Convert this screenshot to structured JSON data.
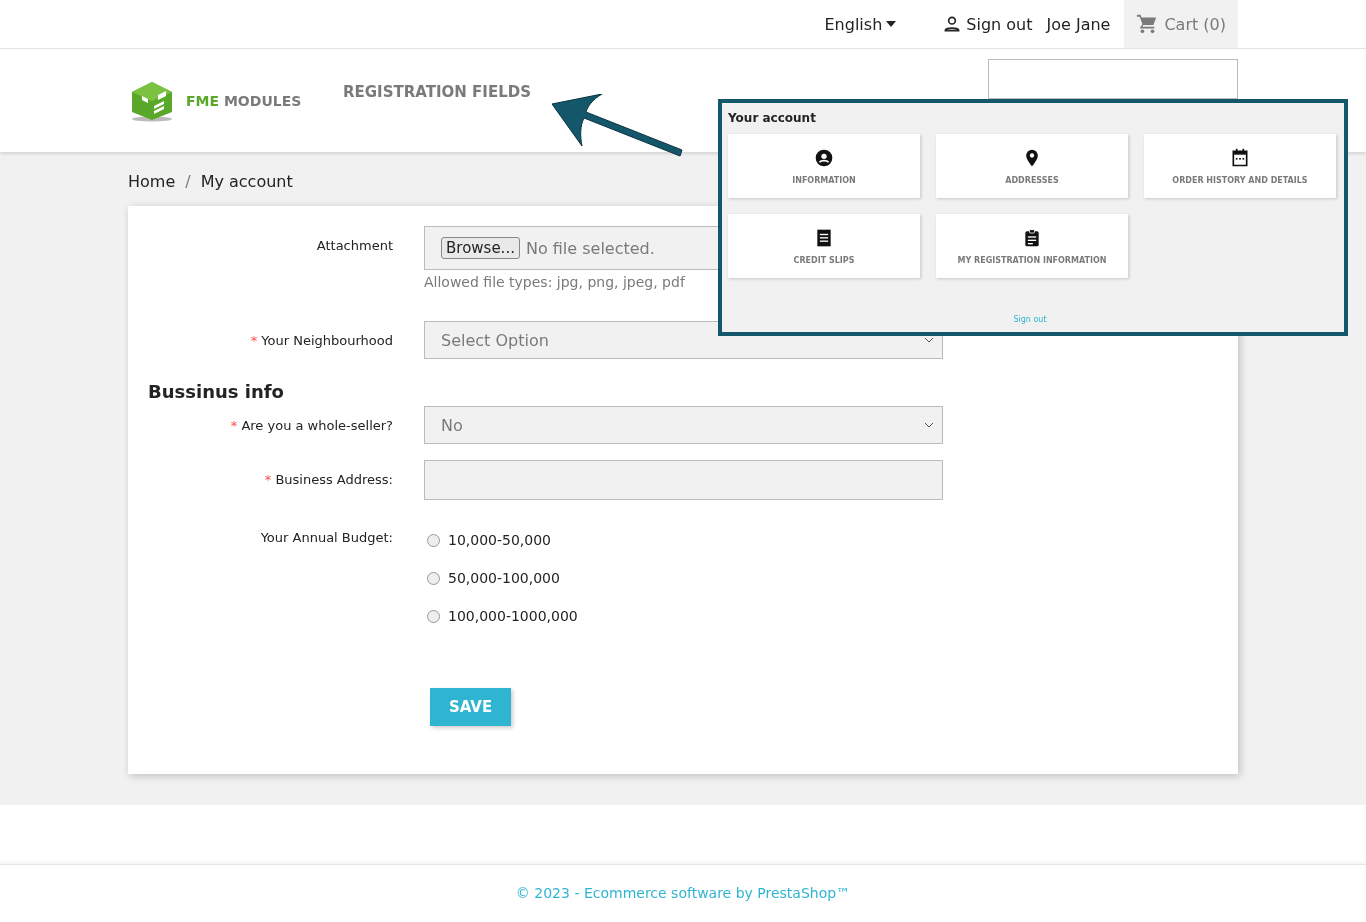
{
  "top_bar": {
    "language": "English",
    "sign_out": "Sign out",
    "user": "Joe Jane",
    "cart": "Cart (0)"
  },
  "header": {
    "logo_accent": "FME",
    "logo_rest": "MODULES",
    "nav": "REGISTRATION FIELDS"
  },
  "breadcrumb": {
    "items": [
      "Home",
      "My account"
    ],
    "separator": "/"
  },
  "form": {
    "fields": [
      {
        "kind": "file",
        "label": "Attachment",
        "button": "Browse...",
        "value": "No file selected.",
        "hint": "Allowed file types: jpg, png, jpeg, pdf"
      },
      {
        "kind": "select",
        "label": "Your Neighbourhood",
        "required_mark": "*",
        "value": "Select Option"
      },
      {
        "kind": "heading",
        "label": "Bussinus info"
      },
      {
        "kind": "select",
        "label": "Are you a whole-seller?",
        "required_mark": "*",
        "value": "No"
      },
      {
        "kind": "text",
        "label": "Business Address:",
        "required_mark": "*"
      },
      {
        "kind": "radio",
        "label": "Your Annual Budget:",
        "options": [
          {
            "label": "10,000-50,000",
            "selected": false
          },
          {
            "label": "50,000-100,000",
            "selected": false
          },
          {
            "label": "100,000-1000,000",
            "selected": false
          }
        ]
      }
    ],
    "save": "SAVE"
  },
  "account_panel": {
    "title": "Your account",
    "tiles": [
      {
        "kind": "person",
        "label": "INFORMATION"
      },
      {
        "kind": "pin",
        "label": "ADDRESSES"
      },
      {
        "kind": "calendar",
        "label": "ORDER HISTORY AND DETAILS"
      },
      {
        "kind": "receipt",
        "label": "CREDIT SLIPS"
      },
      {
        "kind": "clipboard",
        "label": "MY REGISTRATION INFORMATION"
      }
    ],
    "sign_out": "Sign out"
  },
  "footer": "© 2023 - Ecommerce software by PrestaShop™"
}
